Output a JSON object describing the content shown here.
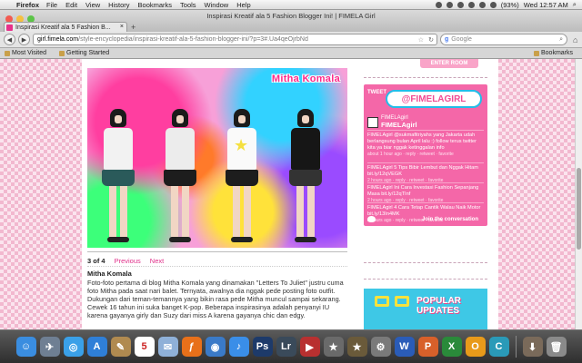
{
  "menubar": {
    "app": "Firefox",
    "menus": [
      "File",
      "Edit",
      "View",
      "History",
      "Bookmarks",
      "Tools",
      "Window",
      "Help"
    ],
    "battery": "(93%)",
    "clock": "Wed 12:57 AM"
  },
  "window": {
    "title": "Inspirasi Kreatif ala 5 Fashion Blogger Ini! | FIMELA Girl",
    "tab_label": "Inspirasi Kreatif ala 5 Fashion B...",
    "new_tab": "+"
  },
  "navbar": {
    "url_domain": "girl.fimela.com",
    "url_path": "/style-encyclopedia/inspirasi-kreatif-ala-5-fashion-blogger-ini/?p=3#.Ua4qeOjrbNd",
    "search_engine": "Google"
  },
  "bookmarks": {
    "most_visited": "Most Visited",
    "getting_started": "Getting Started",
    "bookmarks_menu": "Bookmarks"
  },
  "article": {
    "photo_caption": "Mitha Komala",
    "pager_count": "3 of 4",
    "previous": "Previous",
    "next": "Next",
    "heading": "Mitha Komala",
    "body": "Foto-foto pertama di blog Mitha Komala yang dinamakan \"Letters To Juliet\" justru cuma foto Mitha pada saat nari balet. Ternyata, awalnya dia nggak pede posting foto outfit. Dukungan dari teman-temannya yang bikin rasa pede Mitha muncul sampai sekarang. Cewek 16 tahun ini suka banget K-pop. Beberapa inspirasinya adalah penyanyi IU karena gayanya girly dan Suzy dari miss A karena gayanya chic dan edgy."
  },
  "sidebar": {
    "enter_room": "ENTER ROOM",
    "twitter": {
      "tweet_label": "TWEET",
      "handle": "@FIMELAGIRL",
      "profile_small": "FIMELAgirl",
      "profile_name": "FIMELAgirl",
      "tweets": [
        {
          "text": "FIMELAgirl @sukmafitriyahs yang Jakarta udah berlangsung bulan April lalu :) follow terus twitter kita ya biar nggak ketinggalan info",
          "meta": "about 1 hour ago · reply · retweet · favorite"
        },
        {
          "text": "FIMELAgirl 5 Tips Bibir Lembut dan Nggak Hitam bit.ly/12qVEGK",
          "meta": "2 hours ago · reply · retweet · favorite"
        },
        {
          "text": "FIMELAgirl Ini Cara Investasi Fashion Sepanjang Masa bit.ly/12qTInf",
          "meta": "2 hours ago · reply · retweet · favorite"
        },
        {
          "text": "FIMELAgirl 4 Cara Tetap Cantik Walau Naik Motor bit.ly/13In4MK",
          "meta": "2 hours ago · reply · retweet · favorite"
        }
      ],
      "join": "Join the conversation"
    },
    "popular": "POPULAR UPDATES"
  },
  "dock": {
    "calendar_day": "5",
    "apps": [
      {
        "name": "finder-icon",
        "label": "☺",
        "color": "#3a8de0"
      },
      {
        "name": "launchpad-icon",
        "label": "✈",
        "color": "#6f7f93"
      },
      {
        "name": "safari-icon",
        "label": "◎",
        "color": "#3aa0e8"
      },
      {
        "name": "app-store-icon",
        "label": "A",
        "color": "#2f7fd8"
      },
      {
        "name": "preview-icon",
        "label": "✎",
        "color": "#b08a50"
      },
      {
        "name": "mail-icon",
        "label": "✉",
        "color": "#8fb0d8"
      },
      {
        "name": "firefox-icon",
        "label": "ƒ",
        "color": "#e8701a"
      },
      {
        "name": "network-icon",
        "label": "◉",
        "color": "#3a7ac8"
      },
      {
        "name": "itunes-icon",
        "label": "♪",
        "color": "#3a8ee8"
      },
      {
        "name": "photoshop-icon",
        "label": "Ps",
        "color": "#1d3a6a"
      },
      {
        "name": "lightroom-icon",
        "label": "Lr",
        "color": "#3a4a5a"
      },
      {
        "name": "media-icon",
        "label": "▶",
        "color": "#b83030"
      },
      {
        "name": "photos-icon",
        "label": "★",
        "color": "#6a6a6a"
      },
      {
        "name": "imovie-icon",
        "label": "★",
        "color": "#6a5a3a"
      },
      {
        "name": "system-preferences-icon",
        "label": "⚙",
        "color": "#7a7a7a"
      },
      {
        "name": "word-icon",
        "label": "W",
        "color": "#2a5cb8"
      },
      {
        "name": "powerpoint-icon",
        "label": "P",
        "color": "#d8602a"
      },
      {
        "name": "excel-icon",
        "label": "X",
        "color": "#2a8a3a"
      },
      {
        "name": "outlook-icon",
        "label": "O",
        "color": "#e89a1a"
      },
      {
        "name": "communicator-icon",
        "label": "C",
        "color": "#2a9ab8"
      },
      {
        "name": "downloads-icon",
        "label": "⬇",
        "color": "#7a6a5a"
      },
      {
        "name": "trash-icon",
        "label": "🗑",
        "color": "#8a8a8a"
      }
    ]
  }
}
